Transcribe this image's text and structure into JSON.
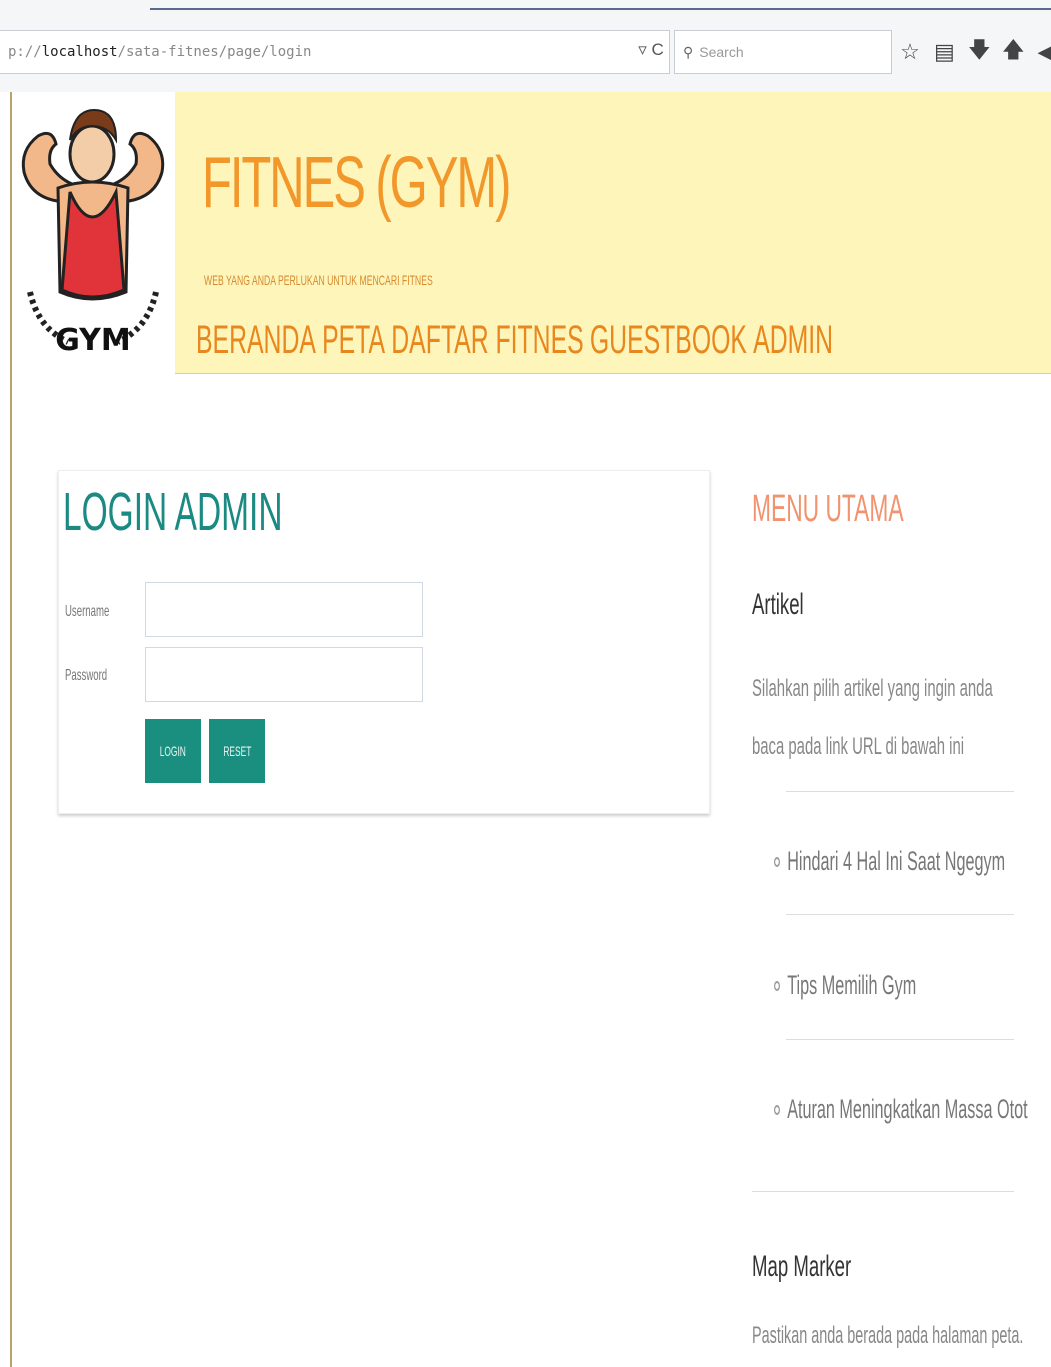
{
  "browser": {
    "url_prefix": "p://",
    "url_host": "localhost",
    "url_path": "/sata-fitnes/page/login",
    "search_placeholder": "Search",
    "reload_label": "▿ C",
    "search_icon": "search-icon",
    "toolbar_icons": [
      "star-icon",
      "reading-list-icon",
      "download-icon",
      "home-icon",
      "send-icon"
    ]
  },
  "header": {
    "title": "FITNES (GYM)",
    "tagline": "WEB YANG ANDA PERLUKAN UNTUK MENCARI FITNES",
    "logo_text": "GYM",
    "nav": [
      "BERANDA",
      "PETA",
      "DAFTAR FITNES",
      "GUESTBOOK",
      "ADMIN"
    ]
  },
  "login": {
    "title": "LOGIN ADMIN",
    "username_label": "Username",
    "password_label": "Password",
    "login_button": "LOGIN",
    "reset_button": "RESET",
    "username_value": "",
    "password_value": ""
  },
  "sidebar": {
    "menu_title": "MENU UTAMA",
    "artikel_heading": "Artikel",
    "artikel_desc": "Silahkan pilih artikel yang ingin anda baca pada link URL di bawah ini",
    "articles": [
      "Hindari 4 Hal Ini Saat Ngegym",
      "Tips Memilih Gym",
      "Aturan Meningkatkan Massa Otot"
    ],
    "map_heading": "Map Marker",
    "map_desc": "Pastikan anda berada pada halaman peta."
  },
  "colors": {
    "header_bg": "#fdf5b9",
    "title_orange": "#f2972a",
    "teal": "#1a8a82",
    "button_teal": "#1a8f7f",
    "menu_salmon": "#f0936e"
  }
}
